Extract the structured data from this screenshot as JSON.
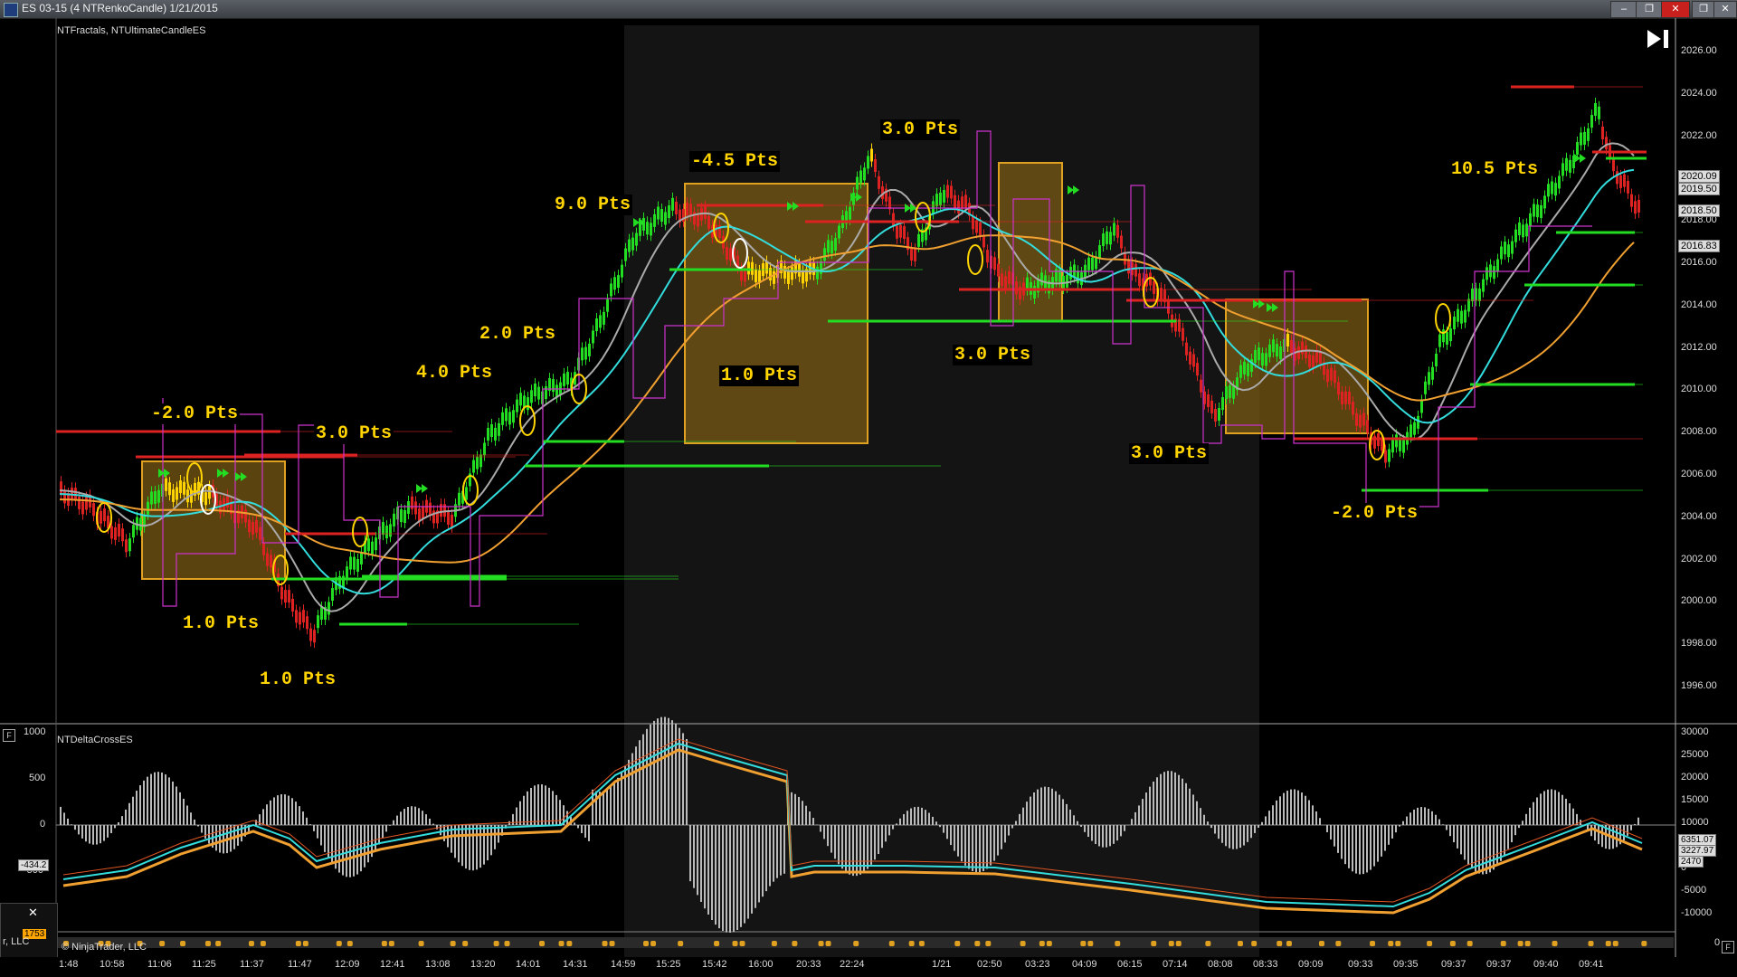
{
  "window": {
    "title": "ES 03-15 (4 NTRenkoCandle)  1/21/2015"
  },
  "price_pane": {
    "indicator_label": "NTFractals, NTUltimateCandleES",
    "y_ticks": [
      "2026.00",
      "2024.00",
      "2022.00",
      "2020.00",
      "2018.00",
      "2016.00",
      "2014.00",
      "2012.00",
      "2010.00",
      "2008.00",
      "2006.00",
      "2004.00",
      "2002.00",
      "2000.00",
      "1998.00",
      "1996.00"
    ],
    "price_boxes": [
      "2020.09",
      "2019.50",
      "2018.50",
      "2016.83"
    ],
    "annotations": [
      {
        "text": "-2.0 Pts"
      },
      {
        "text": "3.0 Pts"
      },
      {
        "text": "1.0 Pts"
      },
      {
        "text": "1.0 Pts"
      },
      {
        "text": "4.0 Pts"
      },
      {
        "text": "2.0 Pts"
      },
      {
        "text": "9.0 Pts"
      },
      {
        "text": "-4.5 Pts"
      },
      {
        "text": "1.0 Pts"
      },
      {
        "text": "3.0 Pts"
      },
      {
        "text": "3.0 Pts"
      },
      {
        "text": "3.0 Pts"
      },
      {
        "text": "-2.0 Pts"
      },
      {
        "text": "10.5 Pts"
      }
    ]
  },
  "osc_pane": {
    "indicator_label": "NTDeltaCrossES",
    "left_ticks": [
      "1000",
      "500",
      "0",
      "-500"
    ],
    "left_box": "-434.2",
    "right_ticks": [
      "30000",
      "25000",
      "20000",
      "15000",
      "10000",
      "5000",
      "0",
      "-5000",
      "-10000"
    ],
    "right_boxes": [
      "6351.07",
      "3227.97",
      "2470"
    ]
  },
  "x_axis": {
    "ticks": [
      "1:48",
      "10:58",
      "11:06",
      "11:25",
      "11:37",
      "11:47",
      "12:09",
      "12:41",
      "13:08",
      "13:20",
      "14:01",
      "14:31",
      "14:59",
      "15:25",
      "15:42",
      "16:00",
      "20:33",
      "22:24",
      "1/21",
      "02:50",
      "03:23",
      "04:09",
      "06:15",
      "07:14",
      "08:08",
      "08:33",
      "09:09",
      "09:33",
      "09:35",
      "09:37",
      "09:37",
      "09:40",
      "09:41"
    ]
  },
  "footer": {
    "copyright": "© NinjaTrader, LLC",
    "mini_badge": "1753",
    "mini_text": "r, LLC",
    "right_zero": "0",
    "f_label": "F"
  },
  "colors": {
    "up": "#22dd22",
    "down": "#dd2222",
    "neutral": "#ffd400",
    "cyan": "#33dddd",
    "orange": "#f0a030",
    "gray": "#aaaaaa",
    "magenta": "#cc33cc",
    "box_fill": "#7a5a14",
    "box_border": "#e0a020"
  },
  "icons": {
    "skip": "skip-to-end-icon",
    "close": "close-icon",
    "app": "app-icon"
  }
}
